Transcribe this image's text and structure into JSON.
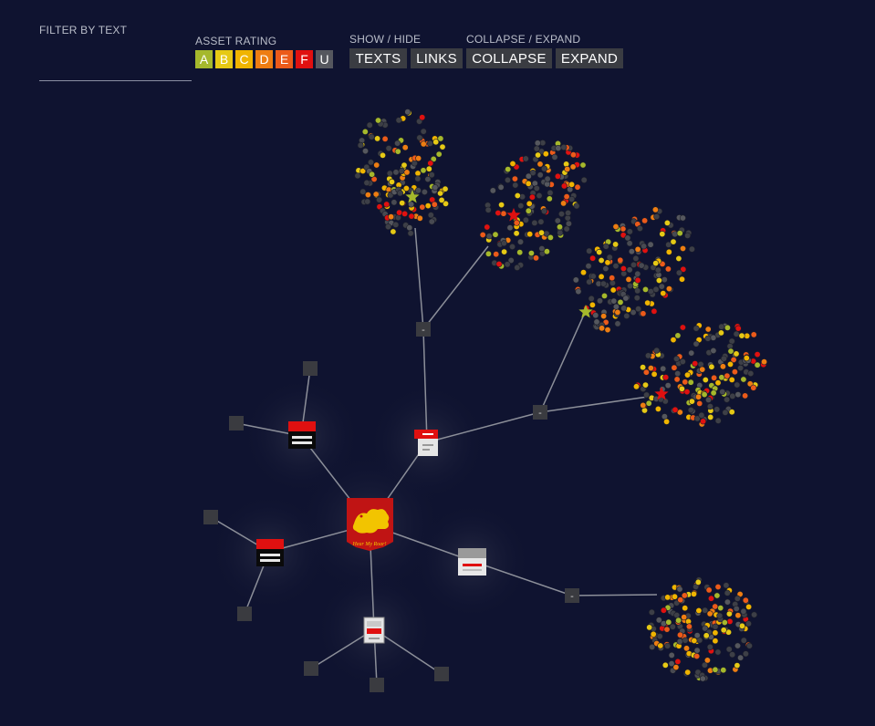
{
  "filter": {
    "label": "FILTER BY TEXT",
    "value": "",
    "placeholder": ""
  },
  "rating": {
    "label": "ASSET RATING",
    "buttons": [
      {
        "label": "A",
        "color": "#a5b82c"
      },
      {
        "label": "B",
        "color": "#e6c915"
      },
      {
        "label": "C",
        "color": "#f0b400"
      },
      {
        "label": "D",
        "color": "#ee7d12"
      },
      {
        "label": "E",
        "color": "#ec5a1a"
      },
      {
        "label": "F",
        "color": "#e01010"
      },
      {
        "label": "U",
        "color": "#55575e"
      }
    ]
  },
  "show_hide": {
    "label": "SHOW / HIDE",
    "texts": "TEXTS",
    "links": "LINKS"
  },
  "collapse_expand": {
    "label": "COLLAPSE / EXPAND",
    "collapse": "COLLAPSE",
    "expand": "EXPAND"
  },
  "graph": {
    "hub_caption": "Hear My Roar!",
    "collapse_marker": "-",
    "colors": {
      "background": "#0f1330",
      "link": "#8c8f99",
      "hub": "#c01414",
      "lion": "#f2c400",
      "node_gray": "#3d3f47"
    }
  }
}
